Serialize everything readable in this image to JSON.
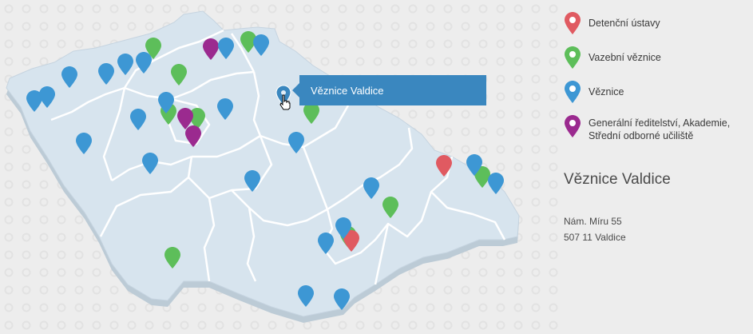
{
  "legend": {
    "items": [
      {
        "label": "Detenční ústavy",
        "color": "#e05a61"
      },
      {
        "label": "Vazební věznice",
        "color": "#5dbe5a"
      },
      {
        "label": "Věznice",
        "color": "#3d97d4"
      },
      {
        "label": "Generální ředitelství, Akademie, Střední odborné učiliště",
        "color": "#9b2a8f"
      }
    ]
  },
  "tooltip": {
    "label": "Věznice Valdice"
  },
  "selected": {
    "title": "Věznice Valdice",
    "address_line1": "Nám. Míru 55",
    "address_line2": "507 11 Valdice"
  },
  "colors": {
    "background": "#ededed",
    "map_fill": "#d7e4ee",
    "map_shadow": "#bccbd6",
    "border": "#ffffff",
    "accent": "#3a87bf"
  }
}
